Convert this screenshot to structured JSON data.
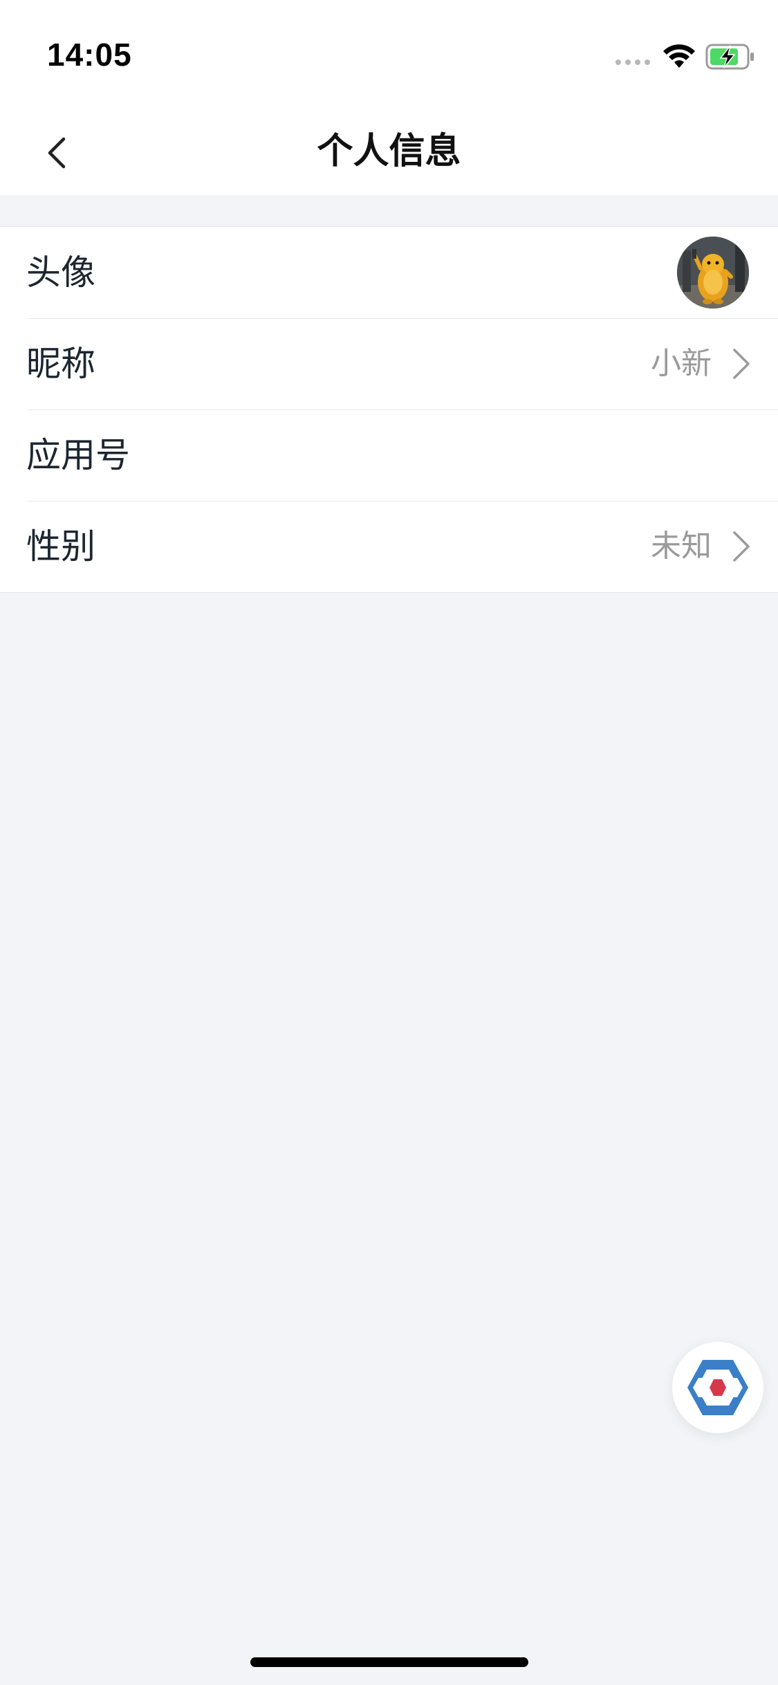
{
  "status_bar": {
    "time": "14:05",
    "icons": [
      "signal-dots-icon",
      "wifi-icon",
      "battery-charging-icon"
    ],
    "battery_color": "#4cd964"
  },
  "nav": {
    "title": "个人信息",
    "back_icon": "chevron-left-icon"
  },
  "profile": {
    "rows": [
      {
        "label": "头像",
        "value": "",
        "type": "avatar"
      },
      {
        "label": "昵称",
        "value": "小新",
        "type": "link"
      },
      {
        "label": "应用号",
        "value": "",
        "type": "static"
      },
      {
        "label": "性别",
        "value": "未知",
        "type": "link"
      }
    ]
  },
  "floating_button": {
    "icon": "hexagon-logo-icon",
    "colors": {
      "outer": "#3a7fc8",
      "inner": "#d7374a"
    }
  },
  "theme": {
    "background": "#f3f4f8",
    "text_primary": "#1c2630",
    "text_secondary": "#9a9a9a"
  }
}
